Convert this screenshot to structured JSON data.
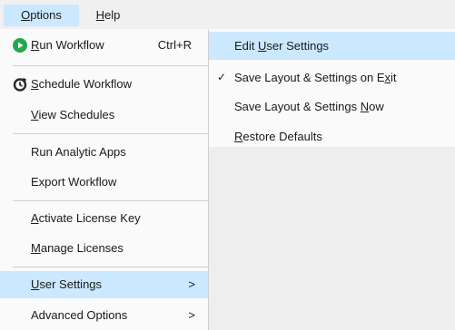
{
  "menubar": {
    "options": {
      "pre": "",
      "u": "O",
      "post": "ptions"
    },
    "help": {
      "pre": "",
      "u": "H",
      "post": "elp"
    }
  },
  "menu": {
    "run_workflow": {
      "pre": "",
      "u": "R",
      "post": "un Workflow",
      "shortcut": "Ctrl+R",
      "icon": "play-circle-icon"
    },
    "schedule_workflow": {
      "pre": "",
      "u": "S",
      "post": "chedule Workflow",
      "icon": "schedule-clock-icon"
    },
    "view_schedules": {
      "pre": "",
      "u": "V",
      "post": "iew Schedules"
    },
    "run_analytic_apps": {
      "label": "Run Analytic Apps"
    },
    "export_workflow": {
      "label": "Export Workflow"
    },
    "activate_license_key": {
      "pre": "",
      "u": "A",
      "post": "ctivate License Key"
    },
    "manage_licenses": {
      "pre": "",
      "u": "M",
      "post": "anage Licenses"
    },
    "user_settings": {
      "pre": "",
      "u": "U",
      "post": "ser Settings",
      "arrow": ">"
    },
    "advanced_options": {
      "label": "Advanced Options",
      "arrow": ">"
    }
  },
  "submenu": {
    "edit_user_settings": {
      "pre": "Edit ",
      "u": "U",
      "post": "ser Settings"
    },
    "save_layout_on_exit": {
      "pre": "Save Layout & Settings on E",
      "u": "x",
      "post": "it",
      "check": "✓"
    },
    "save_layout_now": {
      "pre": "Save Layout & Settings ",
      "u": "N",
      "post": "ow"
    },
    "restore_defaults": {
      "pre": "",
      "u": "R",
      "post": "estore Defaults"
    }
  },
  "colors": {
    "highlight": "#cce8ff",
    "play_icon": "#22a84a"
  }
}
